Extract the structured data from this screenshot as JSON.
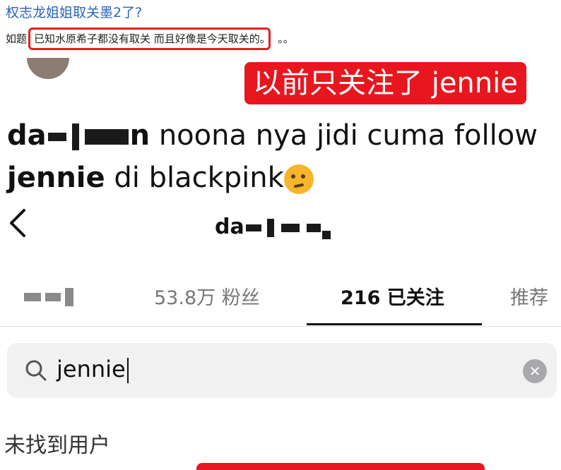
{
  "post": {
    "title": "权志龙姐姐取关墨2了?",
    "body_prefix": "如题",
    "body_highlight": "已知水原希子都没有取关 而且好像是今天取关的。",
    "body_suffix": "。。"
  },
  "banner": {
    "text": "以前只关注了 jennie"
  },
  "comment": {
    "author_visible": "da",
    "author_end": "n",
    "text": "noona nya jidi cuma follow",
    "bold_word": "jennie",
    "text2": "di blackpink"
  },
  "profile": {
    "name_visible": "da"
  },
  "tabs": {
    "followers": "53.8万 粉丝",
    "following": "216 已关注",
    "recommend": "推荐"
  },
  "search": {
    "value": "jennie"
  },
  "empty_state": "未找到用户",
  "colors": {
    "accent_red": "#e8161e",
    "link_blue": "#2a64b8"
  },
  "icons": [
    "back-arrow-icon",
    "search-icon",
    "clear-icon",
    "thinking-face-icon"
  ]
}
